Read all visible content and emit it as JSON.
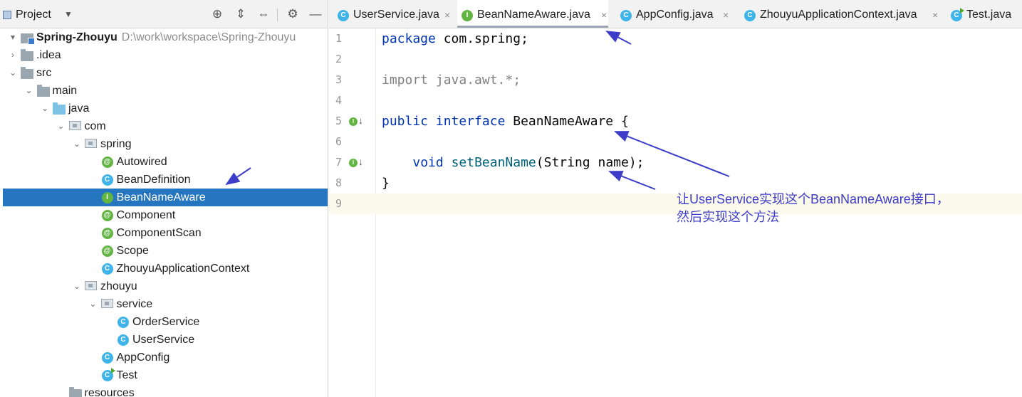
{
  "project": {
    "title": "Project",
    "dropdown": "▼",
    "tools": [
      {
        "name": "locate-icon",
        "glyph": "⊕"
      },
      {
        "name": "expand-all-icon",
        "glyph": "⇕"
      },
      {
        "name": "collapse-all-icon",
        "glyph": "⇔"
      },
      {
        "name": "gear-icon",
        "glyph": "⚙"
      },
      {
        "name": "minimize-icon",
        "glyph": "—"
      }
    ],
    "tree": [
      {
        "label": "Spring-Zhouyu",
        "path": "D:\\work\\workspace\\Spring-Zhouyu",
        "icon": "module",
        "arrow": "▾",
        "depth": 0
      },
      {
        "label": ".idea",
        "icon": "folder",
        "arrow": "›",
        "depth": 0
      },
      {
        "label": "src",
        "icon": "folder",
        "arrow": "⌄",
        "depth": 0
      },
      {
        "label": "main",
        "icon": "folder",
        "arrow": "⌄",
        "depth": 1
      },
      {
        "label": "java",
        "icon": "folder-blue",
        "arrow": "⌄",
        "depth": 2
      },
      {
        "label": "com",
        "icon": "package",
        "arrow": "⌄",
        "depth": 3
      },
      {
        "label": "spring",
        "icon": "package",
        "arrow": "⌄",
        "depth": 4
      },
      {
        "label": "Autowired",
        "icon": "annotation",
        "badge": "@",
        "depth": 5
      },
      {
        "label": "BeanDefinition",
        "icon": "class",
        "badge": "C",
        "depth": 5
      },
      {
        "label": "BeanNameAware",
        "icon": "interface",
        "badge": "I",
        "depth": 5,
        "selected": true
      },
      {
        "label": "Component",
        "icon": "annotation",
        "badge": "@",
        "depth": 5
      },
      {
        "label": "ComponentScan",
        "icon": "annotation",
        "badge": "@",
        "depth": 5
      },
      {
        "label": "Scope",
        "icon": "annotation",
        "badge": "@",
        "depth": 5
      },
      {
        "label": "ZhouyuApplicationContext",
        "icon": "class",
        "badge": "C",
        "depth": 5
      },
      {
        "label": "zhouyu",
        "icon": "package",
        "arrow": "⌄",
        "depth": 4
      },
      {
        "label": "service",
        "icon": "package",
        "arrow": "⌄",
        "depth": 5
      },
      {
        "label": "OrderService",
        "icon": "class",
        "badge": "C",
        "depth": 6
      },
      {
        "label": "UserService",
        "icon": "class",
        "badge": "C",
        "depth": 6
      },
      {
        "label": "AppConfig",
        "icon": "class",
        "badge": "C",
        "depth": 5
      },
      {
        "label": "Test",
        "icon": "class-run",
        "badge": "C",
        "depth": 5
      },
      {
        "label": "resources",
        "icon": "folder",
        "depth": 3
      }
    ]
  },
  "editor": {
    "tabs": [
      {
        "label": "UserService.java",
        "badge": "C",
        "type": "class",
        "close": "×"
      },
      {
        "label": "BeanNameAware.java",
        "badge": "I",
        "type": "interface",
        "close": "×",
        "active": true
      },
      {
        "label": "AppConfig.java",
        "badge": "C",
        "type": "class",
        "close": "×"
      },
      {
        "label": "ZhouyuApplicationContext.java",
        "badge": "C",
        "type": "class",
        "close": "×"
      },
      {
        "label": "Test.java",
        "badge": "C",
        "type": "class-run"
      }
    ],
    "line_numbers": [
      "1",
      "2",
      "3",
      "4",
      "5",
      "6",
      "7",
      "8",
      "9"
    ],
    "gutter_marks": [
      {
        "line": 5,
        "badge": "I",
        "arrow": "↓"
      },
      {
        "line": 7,
        "badge": "I",
        "arrow": "↓"
      }
    ],
    "code": [
      {
        "tokens": [
          {
            "t": "package",
            "c": "kw"
          },
          {
            "t": " com.spring;",
            "c": "pl"
          }
        ]
      },
      {
        "tokens": []
      },
      {
        "tokens": [
          {
            "t": "import java.awt.*;",
            "c": "gray"
          }
        ]
      },
      {
        "tokens": []
      },
      {
        "tokens": [
          {
            "t": "public",
            "c": "kw"
          },
          {
            "t": " ",
            "c": "pl"
          },
          {
            "t": "interface",
            "c": "kw"
          },
          {
            "t": " BeanNameAware {",
            "c": "pl"
          }
        ]
      },
      {
        "tokens": []
      },
      {
        "tokens": [
          {
            "t": "    ",
            "c": "pl"
          },
          {
            "t": "void",
            "c": "kw"
          },
          {
            "t": " ",
            "c": "pl"
          },
          {
            "t": "setBeanName",
            "c": "fn"
          },
          {
            "t": "(String name);",
            "c": "pl"
          }
        ]
      },
      {
        "tokens": [
          {
            "t": "}",
            "c": "pl"
          }
        ]
      },
      {
        "tokens": [],
        "current": true
      }
    ]
  },
  "annotation": {
    "line1": "让UserService实现这个BeanNameAware接口，",
    "line2": "然后实现这个方法",
    "color": "#3d3dc9"
  }
}
